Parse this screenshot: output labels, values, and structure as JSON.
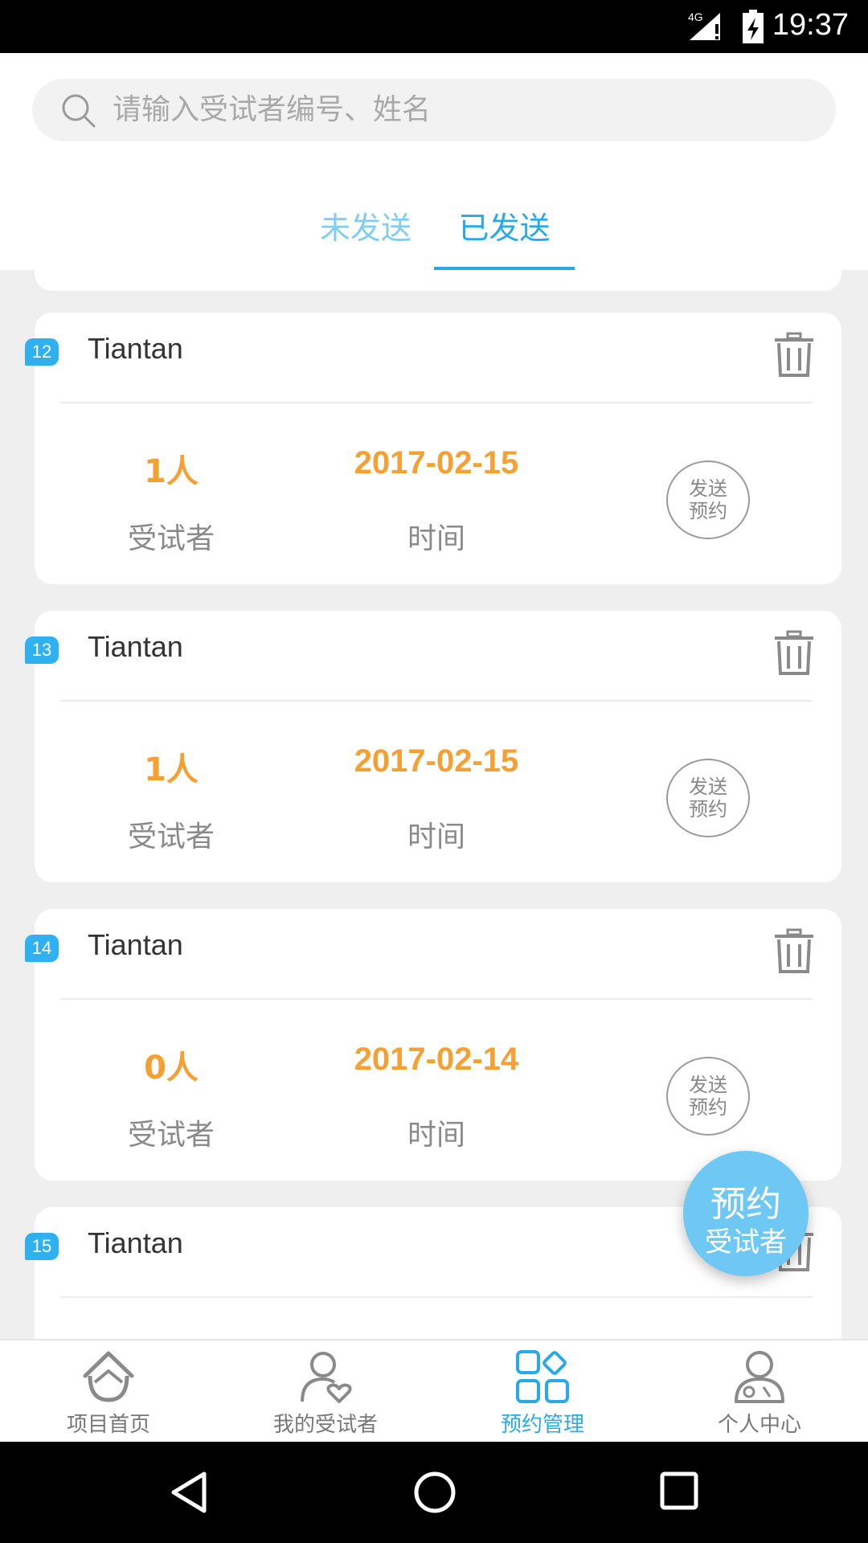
{
  "status_bar": {
    "network": "4G",
    "time": "19:37"
  },
  "search": {
    "placeholder": "请输入受试者编号、姓名"
  },
  "tabs": [
    {
      "label": "未发送",
      "active": false
    },
    {
      "label": "已发送",
      "active": true
    }
  ],
  "cards": [
    {
      "index": "12",
      "name": "Tiantan",
      "count": "1人",
      "count_label": "受试者",
      "date": "2017-02-15",
      "date_label": "时间",
      "send_label_1": "发送",
      "send_label_2": "预约"
    },
    {
      "index": "13",
      "name": "Tiantan",
      "count": "1人",
      "count_label": "受试者",
      "date": "2017-02-15",
      "date_label": "时间",
      "send_label_1": "发送",
      "send_label_2": "预约"
    },
    {
      "index": "14",
      "name": "Tiantan",
      "count": "0人",
      "count_label": "受试者",
      "date": "2017-02-14",
      "date_label": "时间",
      "send_label_1": "发送",
      "send_label_2": "预约"
    },
    {
      "index": "15",
      "name": "Tiantan"
    }
  ],
  "fab": {
    "line1": "预约",
    "line2": "受试者"
  },
  "bottom_nav": [
    {
      "label": "项目首页",
      "icon": "home-icon",
      "active": false
    },
    {
      "label": "我的受试者",
      "icon": "person-heart-icon",
      "active": false
    },
    {
      "label": "预约管理",
      "icon": "grid-icon",
      "active": true
    },
    {
      "label": "个人中心",
      "icon": "profile-icon",
      "active": false
    }
  ],
  "colors": {
    "accent": "#27a9e8",
    "tab_inactive": "#7fcdf3",
    "orange": "#f5a033",
    "badge": "#2fb0f0",
    "fab": "#6fc8f4"
  }
}
